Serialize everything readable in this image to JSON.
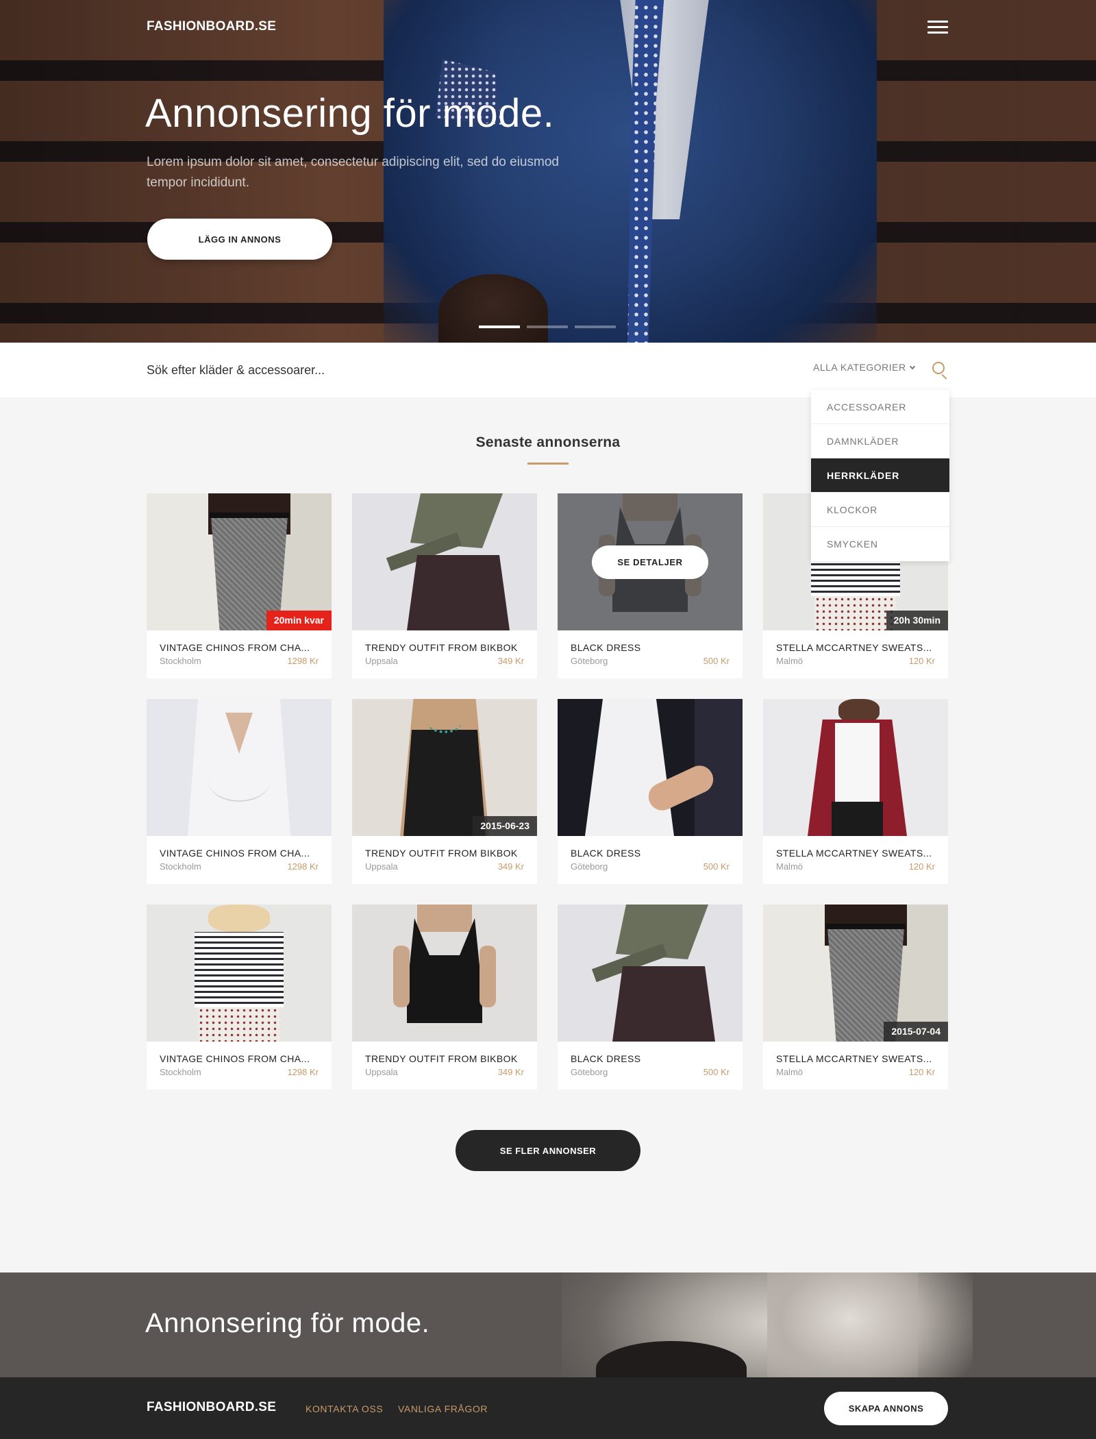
{
  "header": {
    "logo": "FASHIONBOARD.SE",
    "hero_title": "Annonsering för mode.",
    "hero_subtitle": "Lorem ipsum dolor sit amet, consectetur adipiscing elit, sed do eiusmod tempor incididunt.",
    "cta_label": "LÄGG IN ANNONS",
    "slider": {
      "count": 3,
      "active": 1
    }
  },
  "search": {
    "placeholder": "Sök efter kläder & accessoarer...",
    "category_label": "ALLA KATEGORIER",
    "categories": [
      "ACCESSOARER",
      "DAMNKLÄDER",
      "HERRKLÄDER",
      "KLOCKOR",
      "SMYCKEN"
    ],
    "highlighted_category": "HERRKLÄDER"
  },
  "section": {
    "title": "Senaste annonserna",
    "detail_button": "SE DETALJER",
    "more_button": "SE FLER ANNONSER"
  },
  "listings": [
    {
      "title": "VINTAGE CHINOS FROM CHA...",
      "location": "Stockholm",
      "price": "1298 Kr",
      "badge": "20min kvar",
      "badge_urgent": true,
      "image": "chinos"
    },
    {
      "title": "TRENDY OUTFIT FROM BIKBOK",
      "location": "Uppsala",
      "price": "349 Kr",
      "badge": "",
      "image": "skirt"
    },
    {
      "title": "BLACK DRESS",
      "location": "Göteborg",
      "price": "500 Kr",
      "badge": "",
      "hovered": true,
      "image": "black-dress"
    },
    {
      "title": "STELLA MCCARTNEY SWEATS...",
      "location": "Malmö",
      "price": "120 Kr",
      "badge": "20h 30min",
      "image": "striped"
    },
    {
      "title": "VINTAGE CHINOS FROM CHA...",
      "location": "Stockholm",
      "price": "1298 Kr",
      "badge": "",
      "image": "white-blouse"
    },
    {
      "title": "TRENDY OUTFIT FROM BIKBOK",
      "location": "Uppsala",
      "price": "349 Kr",
      "badge": "2015-06-23",
      "image": "black-slip"
    },
    {
      "title": "BLACK DRESS",
      "location": "Göteborg",
      "price": "500 Kr",
      "badge": "",
      "image": "white-shirt-dark"
    },
    {
      "title": "STELLA MCCARTNEY SWEATS...",
      "location": "Malmö",
      "price": "120 Kr",
      "badge": "",
      "image": "red-blazer"
    },
    {
      "title": "VINTAGE CHINOS FROM CHA...",
      "location": "Stockholm",
      "price": "1298 Kr",
      "badge": "",
      "image": "striped"
    },
    {
      "title": "TRENDY OUTFIT FROM BIKBOK",
      "location": "Uppsala",
      "price": "349 Kr",
      "badge": "",
      "image": "black-dress"
    },
    {
      "title": "BLACK DRESS",
      "location": "Göteborg",
      "price": "500 Kr",
      "badge": "",
      "image": "skirt"
    },
    {
      "title": "STELLA MCCARTNEY SWEATS...",
      "location": "Malmö",
      "price": "120 Kr",
      "badge": "2015-07-04",
      "image": "chinos"
    }
  ],
  "banner": {
    "title": "Annonsering för mode."
  },
  "footer": {
    "logo": "FASHIONBOARD.SE",
    "links": [
      "KONTAKTA OSS",
      "VANLIGA FRÅGOR"
    ],
    "cta_label": "SKAPA ANNONS"
  },
  "colors": {
    "accent": "#c99a6a",
    "dark": "#262626",
    "urgent": "#e5231b",
    "background": "#f5f5f5"
  }
}
